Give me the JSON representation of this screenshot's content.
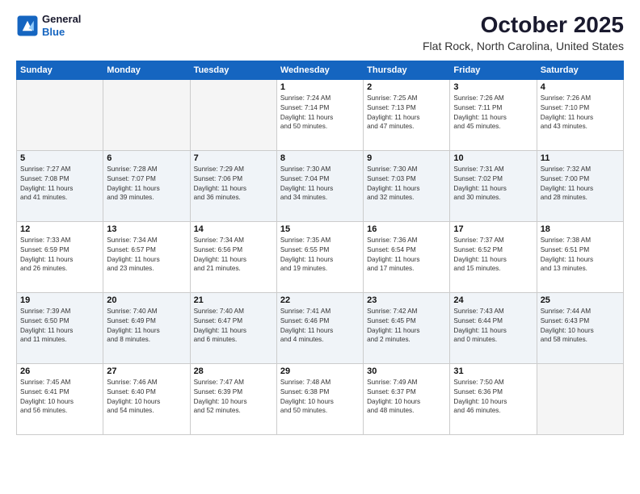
{
  "logo": {
    "line1": "General",
    "line2": "Blue"
  },
  "header": {
    "month": "October 2025",
    "location": "Flat Rock, North Carolina, United States"
  },
  "days_of_week": [
    "Sunday",
    "Monday",
    "Tuesday",
    "Wednesday",
    "Thursday",
    "Friday",
    "Saturday"
  ],
  "weeks": [
    [
      {
        "day": "",
        "info": "",
        "empty": true
      },
      {
        "day": "",
        "info": "",
        "empty": true
      },
      {
        "day": "",
        "info": "",
        "empty": true
      },
      {
        "day": "1",
        "info": "Sunrise: 7:24 AM\nSunset: 7:14 PM\nDaylight: 11 hours\nand 50 minutes.",
        "empty": false
      },
      {
        "day": "2",
        "info": "Sunrise: 7:25 AM\nSunset: 7:13 PM\nDaylight: 11 hours\nand 47 minutes.",
        "empty": false
      },
      {
        "day": "3",
        "info": "Sunrise: 7:26 AM\nSunset: 7:11 PM\nDaylight: 11 hours\nand 45 minutes.",
        "empty": false
      },
      {
        "day": "4",
        "info": "Sunrise: 7:26 AM\nSunset: 7:10 PM\nDaylight: 11 hours\nand 43 minutes.",
        "empty": false
      }
    ],
    [
      {
        "day": "5",
        "info": "Sunrise: 7:27 AM\nSunset: 7:08 PM\nDaylight: 11 hours\nand 41 minutes.",
        "empty": false
      },
      {
        "day": "6",
        "info": "Sunrise: 7:28 AM\nSunset: 7:07 PM\nDaylight: 11 hours\nand 39 minutes.",
        "empty": false
      },
      {
        "day": "7",
        "info": "Sunrise: 7:29 AM\nSunset: 7:06 PM\nDaylight: 11 hours\nand 36 minutes.",
        "empty": false
      },
      {
        "day": "8",
        "info": "Sunrise: 7:30 AM\nSunset: 7:04 PM\nDaylight: 11 hours\nand 34 minutes.",
        "empty": false
      },
      {
        "day": "9",
        "info": "Sunrise: 7:30 AM\nSunset: 7:03 PM\nDaylight: 11 hours\nand 32 minutes.",
        "empty": false
      },
      {
        "day": "10",
        "info": "Sunrise: 7:31 AM\nSunset: 7:02 PM\nDaylight: 11 hours\nand 30 minutes.",
        "empty": false
      },
      {
        "day": "11",
        "info": "Sunrise: 7:32 AM\nSunset: 7:00 PM\nDaylight: 11 hours\nand 28 minutes.",
        "empty": false
      }
    ],
    [
      {
        "day": "12",
        "info": "Sunrise: 7:33 AM\nSunset: 6:59 PM\nDaylight: 11 hours\nand 26 minutes.",
        "empty": false
      },
      {
        "day": "13",
        "info": "Sunrise: 7:34 AM\nSunset: 6:57 PM\nDaylight: 11 hours\nand 23 minutes.",
        "empty": false
      },
      {
        "day": "14",
        "info": "Sunrise: 7:34 AM\nSunset: 6:56 PM\nDaylight: 11 hours\nand 21 minutes.",
        "empty": false
      },
      {
        "day": "15",
        "info": "Sunrise: 7:35 AM\nSunset: 6:55 PM\nDaylight: 11 hours\nand 19 minutes.",
        "empty": false
      },
      {
        "day": "16",
        "info": "Sunrise: 7:36 AM\nSunset: 6:54 PM\nDaylight: 11 hours\nand 17 minutes.",
        "empty": false
      },
      {
        "day": "17",
        "info": "Sunrise: 7:37 AM\nSunset: 6:52 PM\nDaylight: 11 hours\nand 15 minutes.",
        "empty": false
      },
      {
        "day": "18",
        "info": "Sunrise: 7:38 AM\nSunset: 6:51 PM\nDaylight: 11 hours\nand 13 minutes.",
        "empty": false
      }
    ],
    [
      {
        "day": "19",
        "info": "Sunrise: 7:39 AM\nSunset: 6:50 PM\nDaylight: 11 hours\nand 11 minutes.",
        "empty": false
      },
      {
        "day": "20",
        "info": "Sunrise: 7:40 AM\nSunset: 6:49 PM\nDaylight: 11 hours\nand 8 minutes.",
        "empty": false
      },
      {
        "day": "21",
        "info": "Sunrise: 7:40 AM\nSunset: 6:47 PM\nDaylight: 11 hours\nand 6 minutes.",
        "empty": false
      },
      {
        "day": "22",
        "info": "Sunrise: 7:41 AM\nSunset: 6:46 PM\nDaylight: 11 hours\nand 4 minutes.",
        "empty": false
      },
      {
        "day": "23",
        "info": "Sunrise: 7:42 AM\nSunset: 6:45 PM\nDaylight: 11 hours\nand 2 minutes.",
        "empty": false
      },
      {
        "day": "24",
        "info": "Sunrise: 7:43 AM\nSunset: 6:44 PM\nDaylight: 11 hours\nand 0 minutes.",
        "empty": false
      },
      {
        "day": "25",
        "info": "Sunrise: 7:44 AM\nSunset: 6:43 PM\nDaylight: 10 hours\nand 58 minutes.",
        "empty": false
      }
    ],
    [
      {
        "day": "26",
        "info": "Sunrise: 7:45 AM\nSunset: 6:41 PM\nDaylight: 10 hours\nand 56 minutes.",
        "empty": false
      },
      {
        "day": "27",
        "info": "Sunrise: 7:46 AM\nSunset: 6:40 PM\nDaylight: 10 hours\nand 54 minutes.",
        "empty": false
      },
      {
        "day": "28",
        "info": "Sunrise: 7:47 AM\nSunset: 6:39 PM\nDaylight: 10 hours\nand 52 minutes.",
        "empty": false
      },
      {
        "day": "29",
        "info": "Sunrise: 7:48 AM\nSunset: 6:38 PM\nDaylight: 10 hours\nand 50 minutes.",
        "empty": false
      },
      {
        "day": "30",
        "info": "Sunrise: 7:49 AM\nSunset: 6:37 PM\nDaylight: 10 hours\nand 48 minutes.",
        "empty": false
      },
      {
        "day": "31",
        "info": "Sunrise: 7:50 AM\nSunset: 6:36 PM\nDaylight: 10 hours\nand 46 minutes.",
        "empty": false
      },
      {
        "day": "",
        "info": "",
        "empty": true
      }
    ]
  ]
}
